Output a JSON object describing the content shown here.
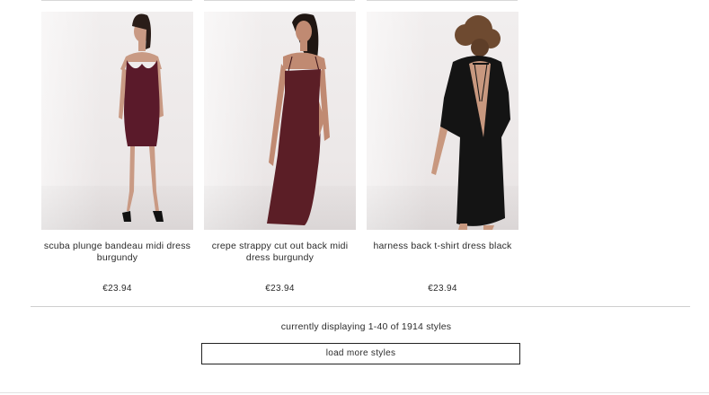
{
  "products": [
    {
      "name": "scuba plunge bandeau midi dress burgundy",
      "price": "€23.94",
      "image_color": "#5a1a2a"
    },
    {
      "name": "crepe strappy cut out back midi dress burgundy",
      "price": "€23.94",
      "image_color": "#5b1e26"
    },
    {
      "name": "harness back t-shirt dress black",
      "price": "€23.94",
      "image_color": "#141414"
    }
  ],
  "pagination": {
    "display_text": "currently displaying 1-40 of 1914 styles",
    "load_more_label": "load more styles"
  }
}
